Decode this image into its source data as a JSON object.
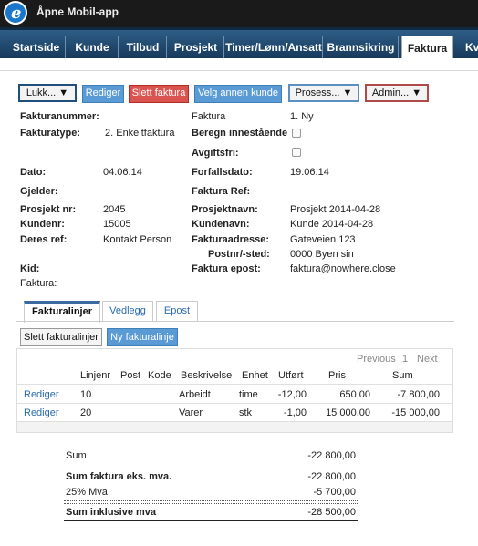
{
  "header": {
    "title": "Åpne Mobil-app",
    "logo_letter": "e"
  },
  "nav": [
    {
      "label": "Startside"
    },
    {
      "label": "Kunde"
    },
    {
      "label": "Tilbud"
    },
    {
      "label": "Prosjekt"
    },
    {
      "label": "Timer/Lønn/Ansatt"
    },
    {
      "label": "Brannsikring"
    },
    {
      "label": "Faktura",
      "active": true
    },
    {
      "label": "Kv"
    }
  ],
  "toolbar": {
    "lukk": "Lukk... ▼",
    "rediger": "Rediger",
    "slett_faktura": "Slett faktura",
    "velg_annen_kunde": "Velg annen kunde",
    "prosess": "Prosess... ▼",
    "admin": "Admin... ▼"
  },
  "form": {
    "fakturanummer_label": "Fakturanummer:",
    "fakturatype_label": "Fakturatype:",
    "fakturatype_value": "2. Enkeltfaktura",
    "faktura_label": "Faktura",
    "faktura_value": "1. Ny",
    "beregn_label": "Beregn innestående",
    "avgiftsfri_label": "Avgiftsfri:",
    "dato_label": "Dato:",
    "dato_value": "04.06.14",
    "forfallsdato_label": "Forfallsdato:",
    "forfallsdato_value": "19.06.14",
    "gjelder_label": "Gjelder:",
    "faktura_ref_label": "Faktura Ref:",
    "prosjekt_nr_label": "Prosjekt nr:",
    "prosjekt_nr_value": "2045",
    "prosjektnavn_label": "Prosjektnavn:",
    "prosjektnavn_value": "Prosjekt 2014-04-28",
    "kundenr_label": "Kundenr:",
    "kundenr_value": "15005",
    "kundenavn_label": "Kundenavn:",
    "kundenavn_value": "Kunde 2014-04-28",
    "deres_ref_label": "Deres ref:",
    "deres_ref_value": "Kontakt Person",
    "fakturaadresse_label": "Fakturaadresse:",
    "fakturaadresse_value": "Gateveien 123",
    "postnr_label": "Postnr/-sted:",
    "postnr_value": "0000 Byen sin",
    "kid_label": "Kid:",
    "faktura_epost_label": "Faktura epost:",
    "faktura_epost_value": "faktura@nowhere.close",
    "faktura_plain_label": "Faktura:"
  },
  "tabs": [
    {
      "label": "Fakturalinjer",
      "active": true
    },
    {
      "label": "Vedlegg"
    },
    {
      "label": "Epost"
    }
  ],
  "lines_toolbar": {
    "slett": "Slett fakturalinjer",
    "ny": "Ny fakturalinje"
  },
  "pager": {
    "previous": "Previous",
    "page": "1",
    "next": "Next"
  },
  "table": {
    "headers": [
      "Linjenr",
      "Post",
      "Kode",
      "Beskrivelse",
      "Enhet",
      "Utført",
      "Pris",
      "Sum"
    ],
    "rows": [
      {
        "action": "Rediger",
        "linjenr": "10",
        "post": "",
        "kode": "",
        "beskrivelse": "Arbeidt",
        "enhet": "time",
        "utfort": "-12,00",
        "pris": "650,00",
        "sum": "-7 800,00"
      },
      {
        "action": "Rediger",
        "linjenr": "20",
        "post": "",
        "kode": "",
        "beskrivelse": "Varer",
        "enhet": "stk",
        "utfort": "-1,00",
        "pris": "15 000,00",
        "sum": "-15 000,00"
      }
    ]
  },
  "summary": {
    "sum_label": "Sum",
    "sum_value": "-22 800,00",
    "eks_mva_label": "Sum faktura eks. mva.",
    "eks_mva_value": "-22 800,00",
    "mva_label": "25% Mva",
    "mva_value": "-5 700,00",
    "inkl_mva_label": "Sum inklusive mva",
    "inkl_mva_value": "-28 500,00"
  },
  "colors": {
    "nav_bg": "#234b70",
    "button_blue": "#5b9bd5",
    "button_red": "#d9534f",
    "link": "#2a6bb0"
  }
}
